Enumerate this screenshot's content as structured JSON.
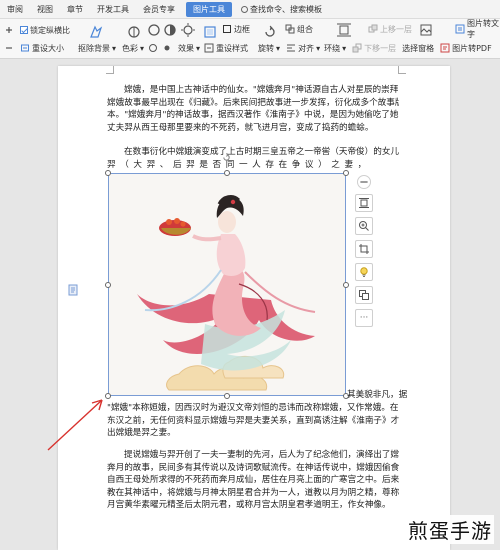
{
  "ribbon": {
    "tabs": [
      "审阅",
      "视图",
      "章节",
      "开发工具",
      "会员专享",
      "图片工具",
      "查找命令、搜索模板"
    ],
    "active_tab_index": 5,
    "accent_color": "#4b86d8"
  },
  "toolbar": {
    "lock_ratio": "锁定纵横比",
    "reset_size": "重设大小",
    "remove_background": "抠除背景",
    "color": "色彩",
    "effects": "效果",
    "border": "边框",
    "reset_style": "重设样式",
    "rotate": "旋转",
    "combine": "组合",
    "align": "对齐",
    "surround": "环绕",
    "bring_forward": "上移一层",
    "send_backward": "下移一层",
    "select_pane": "选择窗格",
    "image_to_text": "图片转文字",
    "image_to_pdf": "图片转PDF"
  },
  "document": {
    "para1": [
      "嫦娥，是中国上古神话中的仙女。\"嫦娥奔月\"神话源自古人对星辰的崇拜，",
      "嫦娥故事最早出现在《归藏》。后来民间把故事进一步发挥，衍化成多个故事版",
      "本。\"嫦娥奔月\"的神话故事，据西汉著作《淮南子》中说，是因为她偷吃了她",
      "丈夫羿从西王母那里要来的不死药，就飞进月宫，变成了捣药的蟾蜍。"
    ],
    "para2_line1": "在数事衍化中嫦娥演变成了上古时期三皇五帝之一帝喾（天帝俊）的女儿、",
    "para2_line2": "羿（大羿、后羿是否同一人存在争议）之妻，",
    "caption_right": "其美貌非凡，据说",
    "para3": [
      "\"嫦娥\"本称姮娥，因西汉时为避汉文帝刘恒的忌讳而改称嫦娥，又作常娥。在",
      "东汉之前，无任何资料显示嫦娥与羿是夫妻关系，直到高诱注解《淮南子》才指",
      "出嫦娥是羿之妻。"
    ],
    "para4": [
      "提说嫦娥与羿开创了一夫一妻制的先河，后人为了纪念他们，演绎出了嫦娥",
      "奔月的故事，民间多有其传说以及诗词歌赋流传。在神话传说中，嫦娥因偷食羿",
      "自西王母处所求得的不死药而奔月成仙，居住在月亮上面的广寒宫之中。后来道",
      "教在其神话中，将嫦娥与月神太阴星君合并为一人，道教以月为阴之精，尊称为",
      "月宫黄华素曜元精圣后太阴元君，或称月宫太阴皇君孝道明王，作女神像。"
    ]
  },
  "watermark": "煎蛋手游"
}
